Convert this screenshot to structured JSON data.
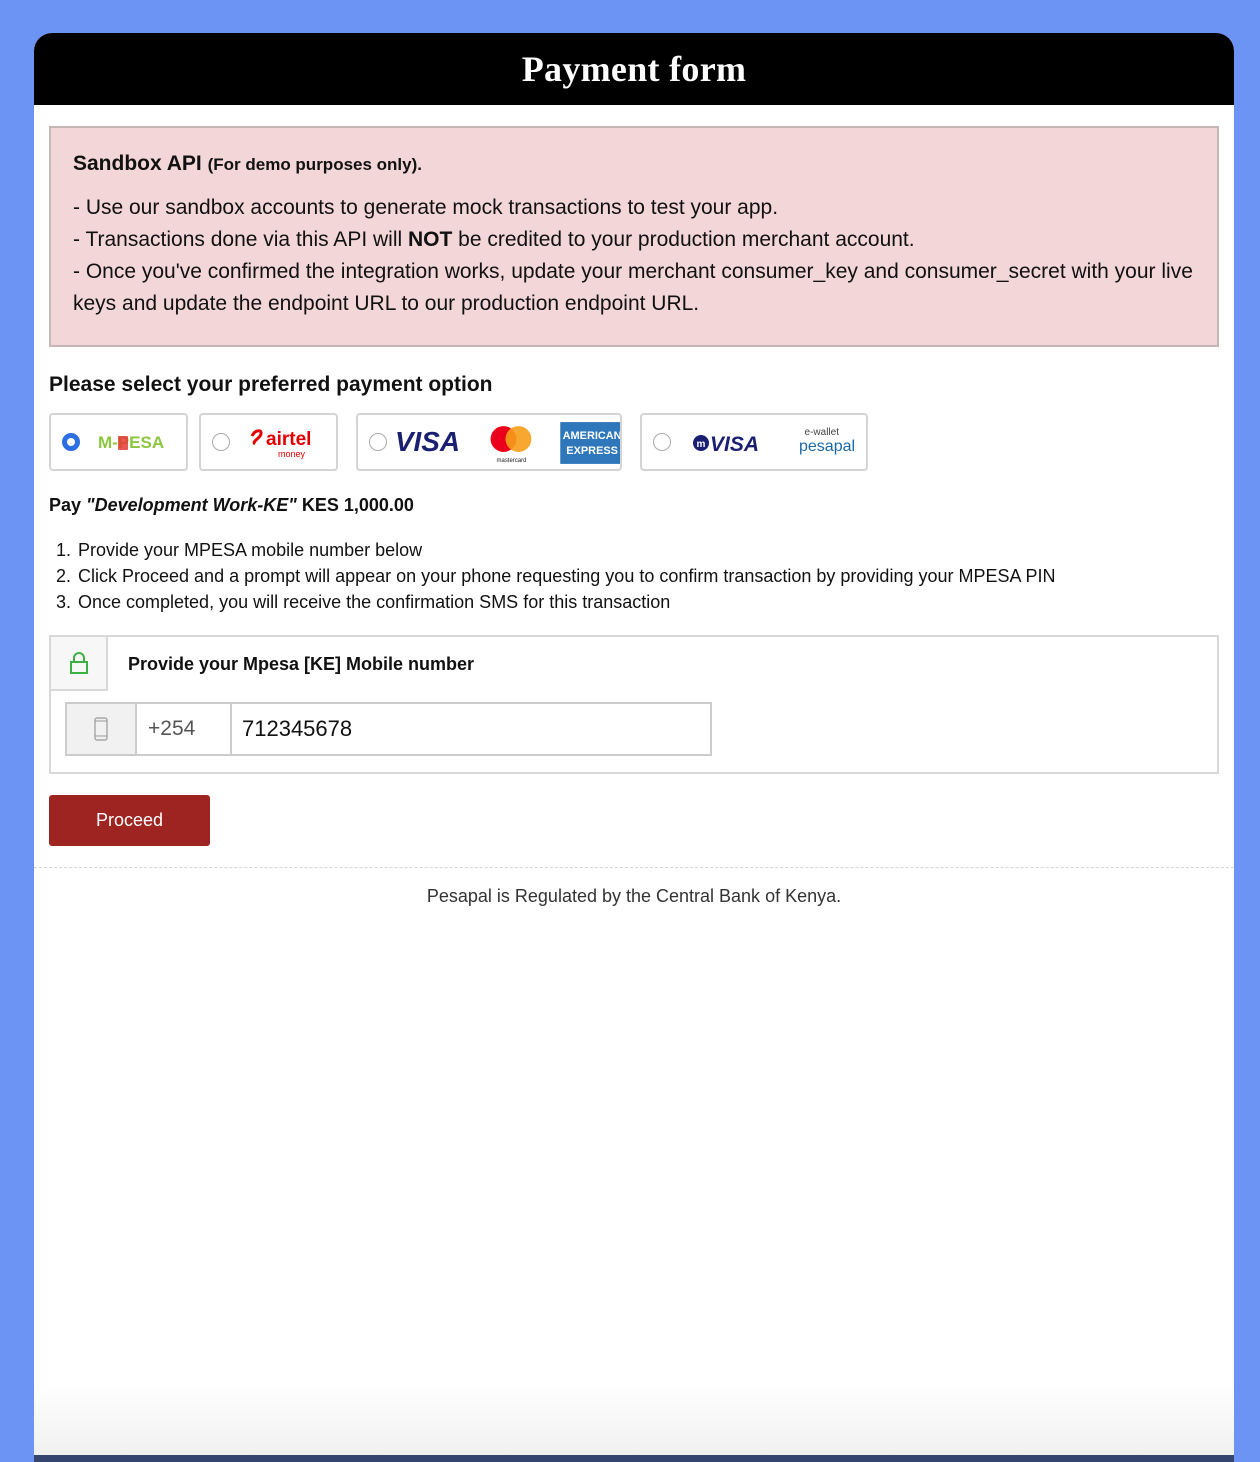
{
  "header": {
    "title": "Payment form"
  },
  "alert": {
    "title": "Sandbox API",
    "title_note": "(For demo purposes only).",
    "line1": "- Use our sandbox accounts to generate mock transactions to test your app.",
    "line2_pre": "- Transactions done via this API will ",
    "line2_bold": "NOT",
    "line2_post": " be credited to your production merchant account.",
    "line3": "- Once you've confirmed the integration works, update your merchant consumer_key and consumer_secret with your live keys and update the endpoint URL to our production endpoint URL."
  },
  "payment_options": {
    "title": "Please select your preferred payment option",
    "options": [
      {
        "logo_text": "M-PESA",
        "selected": true
      },
      {
        "logo_text": "airtel",
        "logo_subtext": "money",
        "selected": false
      },
      {
        "logo_text": "VISA",
        "logo_text_2": "mastercard",
        "logo_text_3": "AMERICAN",
        "logo_text_4": "EXPRESS",
        "selected": false
      },
      {
        "logo_text": "VISA",
        "logo_text_2": "e-wallet",
        "logo_text_3": "pesapal",
        "selected": false
      }
    ]
  },
  "pay": {
    "prefix": "Pay",
    "merchant": "\"Development Work-KE\"",
    "amount": "KES 1,000.00"
  },
  "steps": [
    {
      "num": "1.",
      "text": "Provide your MPESA mobile number below"
    },
    {
      "num": "2.",
      "text": "Click Proceed and a prompt will appear on your phone requesting you to confirm transaction by providing your MPESA PIN"
    },
    {
      "num": "3.",
      "text": "Once completed, you will receive the confirmation SMS for this transaction"
    }
  ],
  "mpesa_form": {
    "label": "Provide your Mpesa [KE] Mobile number",
    "country_code": "+254",
    "phone_value": "712345678"
  },
  "proceed_label": "Proceed",
  "footer_note": "Pesapal is Regulated by the Central Bank of Kenya.",
  "colors": {
    "page_bg": "#6b94f5",
    "proceed": "#9e2421",
    "alert_bg": "#f2d6d8",
    "radio_selected": "#2c6fe3"
  }
}
